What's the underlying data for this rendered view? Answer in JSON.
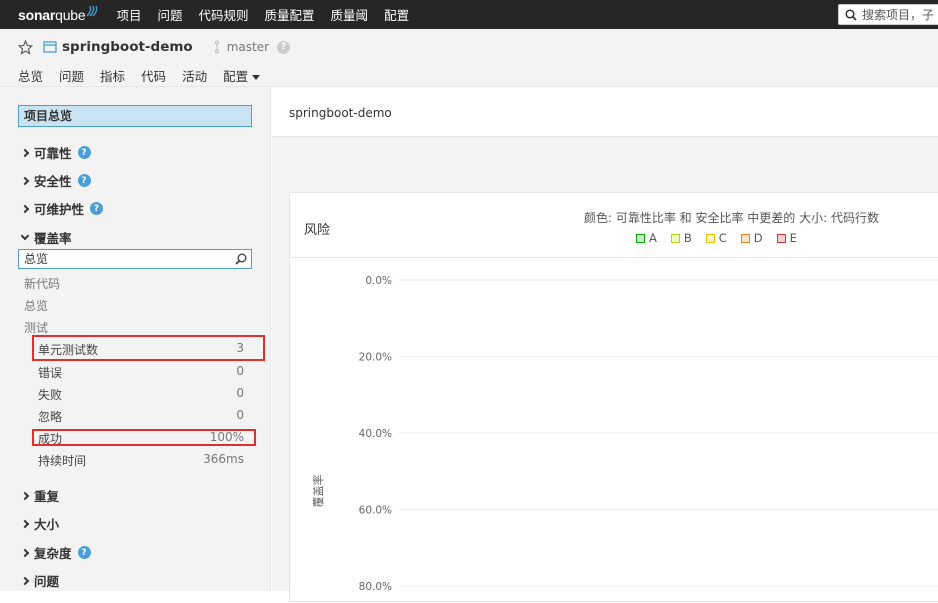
{
  "topnav": {
    "logo_bold": "sonar",
    "logo_light": "qube",
    "items": [
      "项目",
      "问题",
      "代码规则",
      "质量配置",
      "质量阈",
      "配置"
    ],
    "search_placeholder": "搜索项目，子"
  },
  "project": {
    "name": "springboot-demo",
    "branch": "master",
    "tabs": [
      "总览",
      "问题",
      "指标",
      "代码",
      "活动",
      "配置"
    ],
    "active_tab": "指标"
  },
  "sidebar": {
    "overview_label": "项目总览",
    "domains": [
      {
        "label": "可靠性",
        "help": true
      },
      {
        "label": "安全性",
        "help": true
      },
      {
        "label": "可维护性",
        "help": true
      },
      {
        "label": "覆盖率",
        "help": false
      }
    ],
    "coverage_filter": "总览",
    "coverage_categories": [
      "新代码",
      "总览",
      "测试"
    ],
    "test_metrics": [
      {
        "label": "单元测试数",
        "value": "3"
      },
      {
        "label": "错误",
        "value": "0"
      },
      {
        "label": "失败",
        "value": "0"
      },
      {
        "label": "忽略",
        "value": "0"
      },
      {
        "label": "成功",
        "value": "100%"
      },
      {
        "label": "持续时间",
        "value": "366ms"
      }
    ],
    "more_domains": [
      {
        "label": "重复",
        "help": false
      },
      {
        "label": "大小",
        "help": false
      },
      {
        "label": "复杂度",
        "help": true
      },
      {
        "label": "问题",
        "help": false
      }
    ]
  },
  "main": {
    "breadcrumb": "springboot-demo",
    "chart": {
      "title": "风险",
      "description": "颜色: 可靠性比率 和 安全比率 中更差的  大小: 代码行数",
      "legend": [
        {
          "label": "A",
          "fill": "#b0d513",
          "border": "#00aa00",
          "bg": "#c8e6c9"
        },
        {
          "label": "B",
          "fill": "#eaf7b5",
          "border": "#b0d513",
          "bg": "#f1f8c0"
        },
        {
          "label": "C",
          "fill": "#fff4c2",
          "border": "#eabe06",
          "bg": "#fff3c4"
        },
        {
          "label": "D",
          "fill": "#fde0c8",
          "border": "#ed7d20",
          "bg": "#fde2cc"
        },
        {
          "label": "E",
          "fill": "#f8d1d1",
          "border": "#d4333f",
          "bg": "#f6d0d0"
        }
      ],
      "y_axis_label": "覆盖率",
      "y_ticks": [
        "0.0%",
        "20.0%",
        "40.0%",
        "60.0%",
        "80.0%"
      ]
    }
  },
  "chart_data": {
    "type": "scatter",
    "title": "风险",
    "ylabel": "覆盖率",
    "y_ticks": [
      "0.0%",
      "20.0%",
      "40.0%",
      "60.0%",
      "80.0%"
    ],
    "grid": true,
    "legend": [
      "A",
      "B",
      "C",
      "D",
      "E"
    ],
    "series": []
  }
}
